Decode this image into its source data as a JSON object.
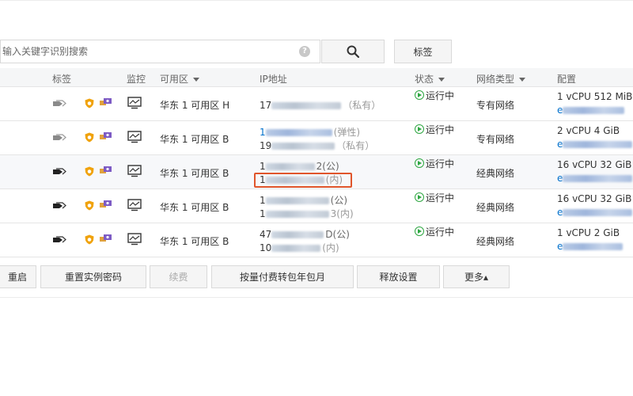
{
  "search": {
    "placeholder": "输入关键字识别搜索",
    "help": "?"
  },
  "toolbar": {
    "tag_label": "标签"
  },
  "columns": {
    "tag": "标签",
    "monitor": "监控",
    "zone": "可用区",
    "ip": "IP地址",
    "status": "状态",
    "network": "网络类型",
    "config": "配置"
  },
  "rows": [
    {
      "zone": "华东 1 可用区 H",
      "ip1": "17",
      "ip1_note": "（私有）",
      "ip2": "",
      "ip2_note": "",
      "status": "运行中",
      "network": "专有网络",
      "cfg": "1 vCPU 512 MiB"
    },
    {
      "zone": "华东 1 可用区 B",
      "ip1": "1",
      "ip1_note": "(弹性)",
      "ip2": "19",
      "ip2_note": "（私有）",
      "status": "运行中",
      "network": "专有网络",
      "cfg": "2 vCPU 4 GiB"
    },
    {
      "zone": "华东 1 可用区 B",
      "ip1": "1",
      "ip1_note": "2(公)",
      "ip2": "1",
      "ip2_note": "(内)",
      "status": "运行中",
      "network": "经典网络",
      "cfg": "16 vCPU 32 GiB"
    },
    {
      "zone": "华东 1 可用区 B",
      "ip1": "1",
      "ip1_note": "(公)",
      "ip2": "1",
      "ip2_note": "3(内)",
      "status": "运行中",
      "network": "经典网络",
      "cfg": "16 vCPU 32 GiB"
    },
    {
      "zone": "华东 1 可用区 B",
      "ip1": "47",
      "ip1_note": "D(公)",
      "ip2": "10",
      "ip2_note": "(内)",
      "status": "运行中",
      "network": "经典网络",
      "cfg": "1 vCPU 2 GiB"
    }
  ],
  "actions": {
    "restart": "重启",
    "reset_password": "重置实例密码",
    "renew": "续费",
    "convert_billing": "按量付费转包年包月",
    "release_settings": "释放设置",
    "more": "更多▴"
  },
  "colors": {
    "running": "#2da641",
    "link": "#0070cc",
    "highlight": "#e0552b"
  }
}
